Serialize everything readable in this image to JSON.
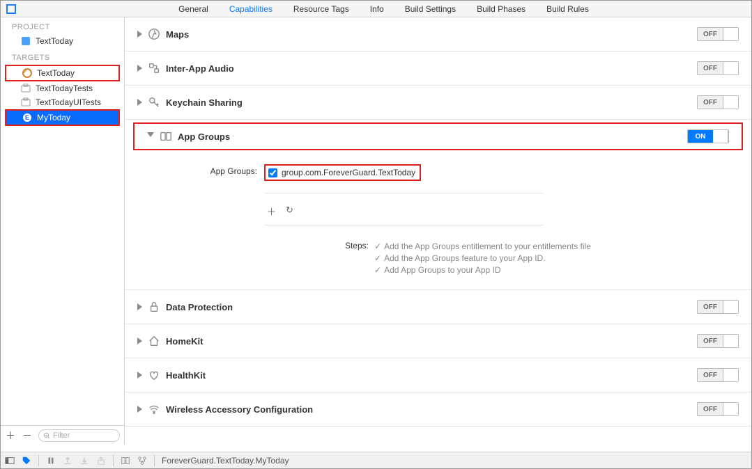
{
  "tabs": {
    "general": "General",
    "capabilities": "Capabilities",
    "resource_tags": "Resource Tags",
    "info": "Info",
    "build_settings": "Build Settings",
    "build_phases": "Build Phases",
    "build_rules": "Build Rules"
  },
  "sidebar": {
    "project_label": "PROJECT",
    "project_name": "TextToday",
    "targets_label": "TARGETS",
    "targets": [
      {
        "name": "TextToday"
      },
      {
        "name": "TextTodayTests"
      },
      {
        "name": "TextTodayUITests"
      },
      {
        "name": "MyToday"
      }
    ],
    "filter_placeholder": "Filter"
  },
  "caps": {
    "maps": "Maps",
    "inter_app_audio": "Inter-App Audio",
    "keychain": "Keychain Sharing",
    "app_groups": "App Groups",
    "data_protection": "Data Protection",
    "homekit": "HomeKit",
    "healthkit": "HealthKit",
    "wireless": "Wireless Accessory Configuration",
    "off": "OFF",
    "on": "ON"
  },
  "app_groups": {
    "label": "App Groups:",
    "item": "group.com.ForeverGuard.TextToday",
    "steps_label": "Steps:",
    "step1": "Add the App Groups entitlement to your entitlements file",
    "step2": "Add the App Groups feature to your App ID.",
    "step3": "Add App Groups to your App ID"
  },
  "statusbar": {
    "breadcrumb": "ForeverGuard.TextToday.MyToday"
  }
}
